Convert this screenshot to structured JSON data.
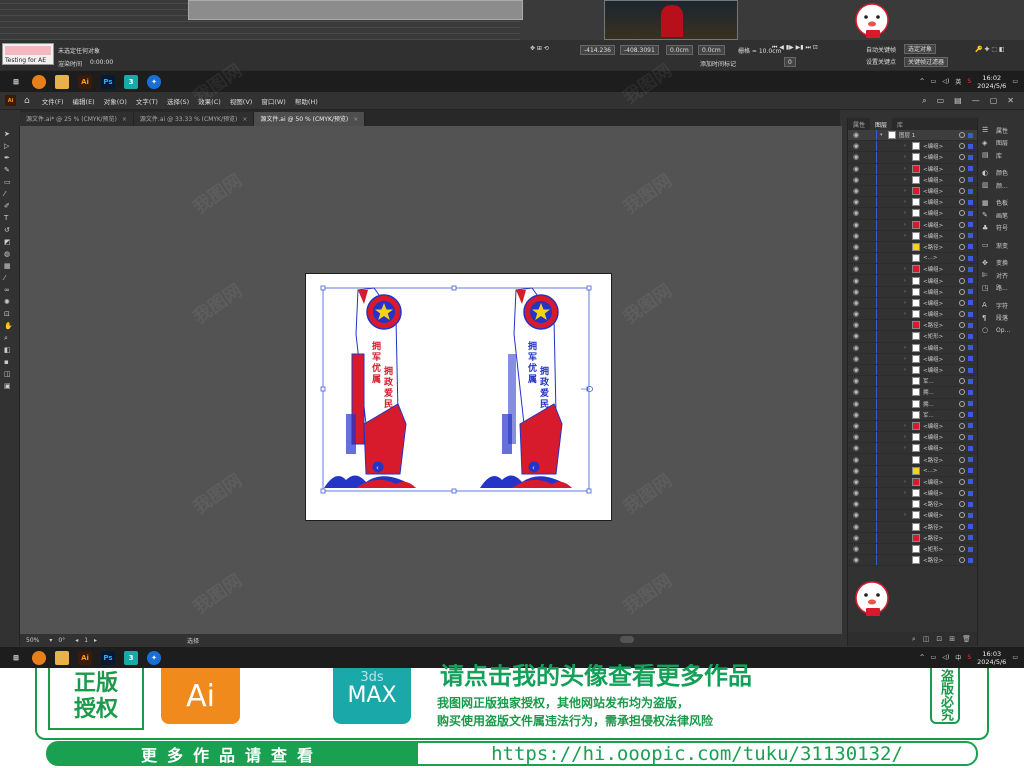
{
  "top": {
    "testing_label": "Testing for AE",
    "no_selection": "未选定任何对象",
    "timecode": "0:00:00",
    "preview_label": "渲染时间",
    "coord1": "-414.236",
    "coord2": "-408.3091",
    "coord3": "0.0cm",
    "coord4": "0.0cm",
    "grid_label": "栅格 = 10.0cm",
    "add_keyframe": "添加时间标记",
    "frame_field": "0",
    "opt1": "自动关键帧",
    "opt2": "设置关键点",
    "opt3": "选定对象",
    "opt4": "关键帧过滤器"
  },
  "taskbar_top": {
    "time": "16:02",
    "date": "2024/5/6",
    "lang": "英",
    "icons": [
      "chrome-icon",
      "explorer-icon",
      "ai-icon",
      "ps-icon",
      "3ds-icon",
      "app-icon"
    ]
  },
  "ai_app": {
    "logo": "Ai",
    "menu": [
      "文件(F)",
      "编辑(E)",
      "对象(O)",
      "文字(T)",
      "选择(S)",
      "效果(C)",
      "视图(V)",
      "窗口(W)",
      "帮助(H)"
    ],
    "tabs": [
      {
        "label": "源文件.ai* @ 25 % (CMYK/预览)",
        "active": false
      },
      {
        "label": "源文件.ai @ 33.33 % (CMYK/预览)",
        "active": false
      },
      {
        "label": "源文件.ai @ 50 % (CMYK/预览)",
        "active": true
      }
    ],
    "status": {
      "zoom": "50%",
      "rotate": "0°",
      "page": "1",
      "tool": "选择"
    }
  },
  "layers": {
    "tabs": [
      "属性",
      "图层",
      "库"
    ],
    "top_layer": "图层 1",
    "rows": [
      "<编组>",
      "<编组>",
      "<编组>",
      "<编组>",
      "<编组>",
      "<编组>",
      "<编组>",
      "<编组>",
      "<编组>",
      "<路径>",
      "<...>",
      "<编组>",
      "<编组>",
      "<编组>",
      "<编组>",
      "<编组>",
      "<路径>",
      "<矩形>",
      "<编组>",
      "<编组>",
      "<编组>",
      "军...",
      "拥...",
      "拥...",
      "军...",
      "<编组>",
      "<编组>",
      "<编组>",
      "<路径>",
      "<...>",
      "<编组>",
      "<编组>",
      "<路径>",
      "<编组>",
      "<路径>",
      "<路径>",
      "<矩形>",
      "<路径>"
    ]
  },
  "props": {
    "items": [
      "属性",
      "图层",
      "库",
      "颜色",
      "颜...",
      "色板",
      "画笔",
      "符号",
      "渐变",
      "变换",
      "对齐",
      "路...",
      "字符",
      "段落",
      "Op..."
    ]
  },
  "taskbar_bottom": {
    "time": "16:03",
    "date": "2024/5/6",
    "lang": "中"
  },
  "banner": {
    "auth": "正版授权",
    "ai": "Ai",
    "max_small": "3ds",
    "max_big": "MAX",
    "headline": "请点击我的头像查看更多作品",
    "line1": "我图网正版独家授权，其他网站发布均为盗版，",
    "line2": "购买使用盗版文件属违法行为，需承担侵权法律风险",
    "stamp": "盗版必究",
    "more": "更多作品请查看",
    "url": "https://hi.ooopic.com/tuku/31130132/"
  },
  "watermark": "我图网",
  "colors": {
    "red": "#d81b2c",
    "blue": "#2433c8",
    "yellow": "#f6d21a",
    "green": "#1aa051"
  }
}
